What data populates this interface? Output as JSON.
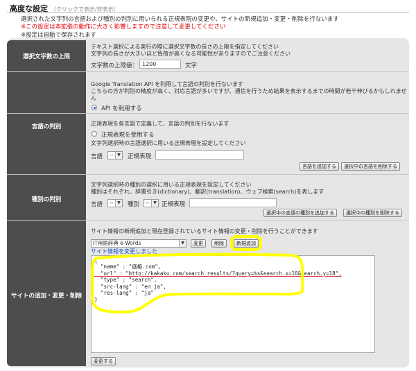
{
  "header": {
    "title": "高度な設定",
    "toggle_note": "（クリックで表示/非表示）",
    "line1": "選択された文字列の言語および種別の判別に用いられる正規表現の変更や、サイトの新規追加・変更・削除を行ないます",
    "warning": "※この設定は本拡張の動作に大きく影響しますので注意して変更してください",
    "autosave": "※設定は自動で保存されます"
  },
  "max_length": {
    "label": "選択文字数の上限",
    "desc1": "テキスト選択による実行の際に選択文字数の長さの上限を指定してください",
    "desc2": "文字列の長さが大きいほど負荷が高くなる可能性がありますのでご注意ください",
    "field_label": "文字数の上限値：",
    "value": "1200",
    "unit": "文字"
  },
  "language": {
    "label": "言語の判別",
    "api_desc1": "Google Translation API を利用して言語の判別を行ないます",
    "api_desc2a": "こちらの方が判別の精度が高く、対応言語が多いですが、通信を行うため結果を表示するまでの時間が若干伸びるかもしれませ",
    "api_desc2b": "ん",
    "api_option": "API を利用する",
    "regex_desc1": "正規表現を各言語で定義して、言語の判別を行ないます",
    "regex_option": "正規表現を使用する",
    "regex_desc2": "文字列選択時の言語選択に用いる正規表現を設定してください",
    "lang_label": "言語",
    "lang_select": "--",
    "regex_label": "正規表現",
    "add_button": "言語を追加する",
    "delete_button": "選択中の言語を削除する"
  },
  "type": {
    "label": "種別の判別",
    "desc1": "文字列選択時の種別の選択に用いる正規表現を設定してください",
    "desc2": "種別はそれぞれ、辞書引き(dictionary)、翻訳(translation)、ウェブ検索(search)を表します",
    "lang_label": "言語",
    "lang_select": "--",
    "type_label": "種別",
    "type_select": "--",
    "regex_label": "正規表現",
    "add_button": "選択中の言語の種別を追加する",
    "delete_button": "選択中の種別を削除する"
  },
  "site": {
    "label": "サイトの追加・変更・削除",
    "desc": "サイト情報の新規追加と現在登録されているサイト情報の変更・削除を行うことができます",
    "select_value": "IT用語辞典 e-Words",
    "change_button": "変更",
    "delete_button": "削除",
    "new_button": "新規追加",
    "status": "サイト情報を変更しました",
    "json_lines": [
      "{",
      "  \"name\" : \"価格.com\",",
      "  \"url\" : \"http://kakaku.com/search_results/?query=%s&search.x=16&search.y=18\",",
      "  \"type\" : \"search\",",
      "  \"src-lang\" : \"en ja\",",
      "  \"res-lang\" : \"ja\"",
      "}"
    ],
    "submit_button": "変更する"
  },
  "colors": {
    "highlight": "#ffff00",
    "label_bg": "#4d4d4d",
    "panel_bg": "#e6e6e6",
    "warning": "#e00000",
    "link": "#1a55c8"
  }
}
